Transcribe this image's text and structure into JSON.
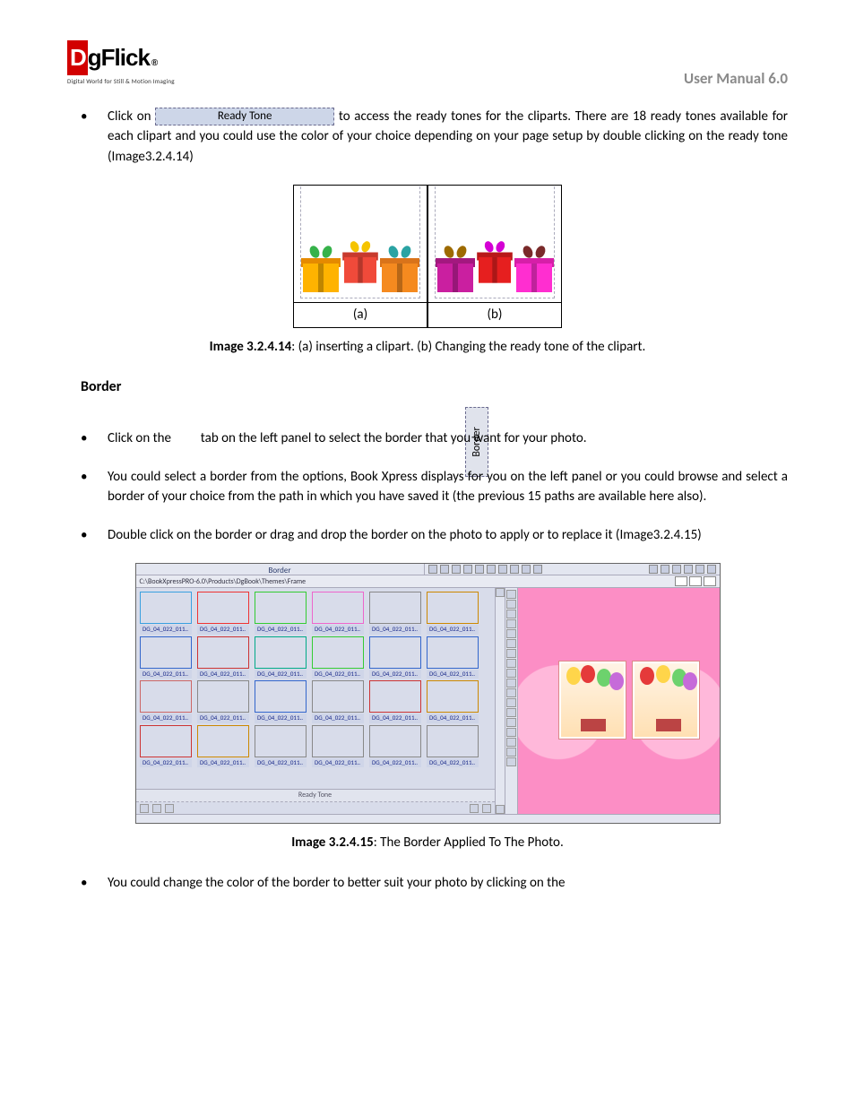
{
  "header": {
    "logo_brand_d": "D",
    "logo_brand_rest": "gFlick",
    "logo_reg": "®",
    "logo_sub": "Digital World for Still & Motion Imaging",
    "right": "User Manual 6.0"
  },
  "ready_tone_btn": "Ready Tone",
  "bullets": {
    "b1a": "Click on ",
    "b1b": " to access the ready tones for the cliparts. There are 18 ready tones available for each clipart and you could use the color of your choice depending on your page setup by double clicking on the ready tone (Image3.2.4.14)",
    "b2a": "Click on the ",
    "b2b": " tab on the left panel to select the border that you want for your photo.",
    "b3": "You could select a border from the options, Book Xpress displays for you on the left panel or you could browse and select a border of your choice from the path in which you have saved it (the previous 15 paths are available here also).",
    "b4": "Double click on the border or drag and drop the border on the photo to apply or to replace it (Image3.2.4.15)",
    "b5": "You could change the color of the border to better suit your photo by clicking on the"
  },
  "fig_ab": {
    "a": "(a)",
    "b": "(b)"
  },
  "caption1_strong": "Image 3.2.4.14",
  "caption1_rest": ": (a) inserting a clipart. (b) Changing the ready tone of the clipart.",
  "section_border": "Border",
  "border_tab_label": "Border",
  "screenshot": {
    "title_left": "Border",
    "path": "C:\\BookXpressPRO-6.0\\Products\\DgBook\\Themes\\Frame",
    "thumb_label": "DG_04_022_011..",
    "ready_tone": "Ready Tone"
  },
  "caption2_strong": "Image 3.2.4.15",
  "caption2_rest": ": The Border Applied To The Photo."
}
